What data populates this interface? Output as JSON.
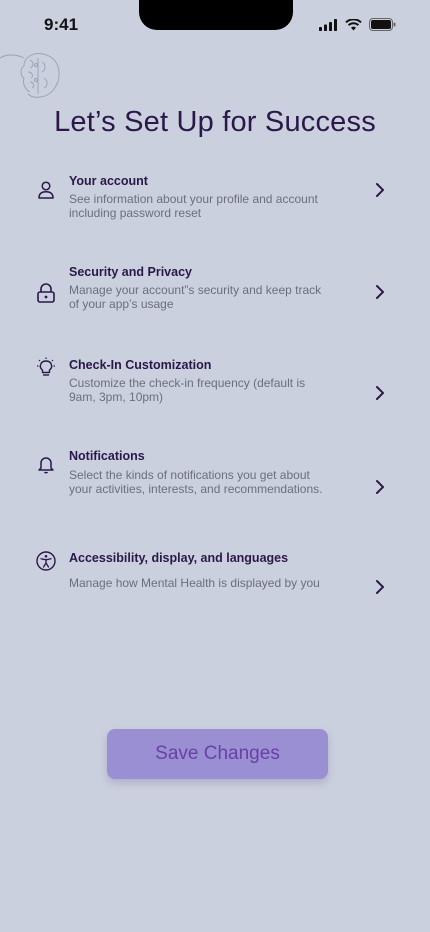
{
  "status_bar": {
    "time": "9:41"
  },
  "page": {
    "title": "Let’s Set Up for Success"
  },
  "settings": [
    {
      "title": "Your account",
      "description": "See information about your profile and account including password reset",
      "icon": "user-icon"
    },
    {
      "title": "Security and Privacy",
      "description": "Manage your account”s security and keep track of your app’s usage",
      "icon": "lock-icon"
    },
    {
      "title": "Check-In Customization",
      "description": "Customize the check-in frequency (default is 9am, 3pm, 10pm)",
      "icon": "lightbulb-icon"
    },
    {
      "title": "Notifications",
      "description": "Select the kinds of notifications you get about your activities, interests, and recommendations.",
      "icon": "bell-icon"
    },
    {
      "title": "Accessibility, display, and languages",
      "description": "Manage how Mental Health is displayed by you",
      "icon": "accessibility-icon"
    }
  ],
  "actions": {
    "save_label": "Save Changes"
  },
  "colors": {
    "background": "#cbd0de",
    "text": "#2a1848",
    "button": "#9a8fd2",
    "button_text": "#6a3fa6"
  }
}
